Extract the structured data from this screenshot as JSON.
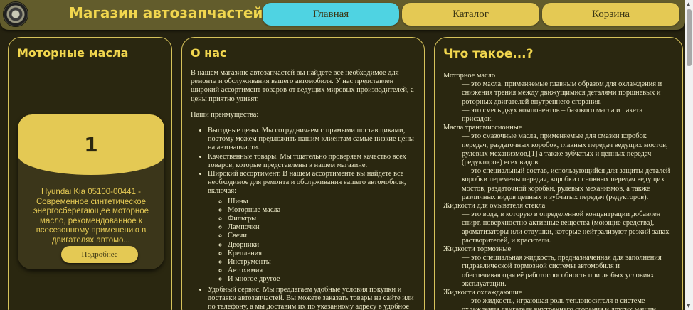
{
  "header": {
    "title": "Магазин автозапчастей",
    "nav": [
      "Главная",
      "Каталог",
      "Корзина"
    ]
  },
  "oils": {
    "title": "Моторные масла",
    "card": {
      "number": "1",
      "description": "Hyundai Kia 05100-00441 - Современное синтетическое энергосберегающее моторное масло, рекомендованное к всесезонному применению в двигателях автомо...",
      "button": "Подробнее"
    }
  },
  "about": {
    "title": "О нас",
    "intro": "В нашем магазине автозапчастей вы найдете все необходимое для ремонта и обслуживания вашего автомобиля. У нас представлен широкий ассортимент товаров от ведущих мировых производителей, а цены приятно удивят.",
    "advantages_heading": "Наши преимущества:",
    "advantages": [
      "Выгодные цены. Мы сотрудничаем с прямыми поставщиками, поэтому можем предложить нашим клиентам самые низкие цены на автозапчасти.",
      "Качественные товары. Мы тщательно проверяем качество всех товаров, которые представлены в нашем магазине.",
      "Широкий ассортимент. В нашем ассортименте вы найдете все необходимое для ремонта и обслуживания вашего автомобиля, включая:",
      "Удобный сервис. Мы предлагаем удобные условия покупки и доставки автозапчастей. Вы можете заказать товары на сайте или по телефону, а мы доставим их по указанному адресу в удобное для вас время."
    ],
    "assortment": [
      "Шины",
      "Моторные масла",
      "Фильтры",
      "Лампочки",
      "Свечи",
      "Дворники",
      "Крепления",
      "Инструменты",
      "Автохимия",
      "И многое другое"
    ]
  },
  "info": {
    "title": "Что такое...?",
    "terms": [
      {
        "term": "Моторное масло",
        "defs": [
          "— это масла, применяемые главным образом для охлаждения и снижения трения между движущимися деталями поршневых и роторных двигателей внутреннего сгорания.",
          "— это смесь двух компонентов – базового масла и пакета присадок."
        ]
      },
      {
        "term": "Масла трансмиссионные",
        "defs": [
          "— это смазочные масла, применяемые для смазки коробок передач, раздаточных коробок, главных передач ведущих мостов, рулевых механизмов,[1] а также зубчатых и цепных передач (редукторов) всех видов.",
          "— это специальный состав, использующийся для защиты деталей коробки перемены передач, коробки основных передач ведущих мостов, раздаточной коробки, рулевых механизмов, а также различных видов цепных и зубчатых передач (редукторов)."
        ]
      },
      {
        "term": "Жидкости для омывателя стекла",
        "defs": [
          "— это вода, в которую в определенной концентрации добавлен спирт, поверхностно-активные вещества (моющие средства), ароматизаторы или отдушки, которые нейтрализуют резкий запах растворителей, и красители."
        ]
      },
      {
        "term": "Жидкости тормозные",
        "defs": [
          "— это специальная жидкость, предназначенная для заполнения гидравлической тормозной системы автомобиля и обеспечивающая её работоспособность при любых условиях эксплуатации."
        ]
      },
      {
        "term": "Жидкости охлаждающие",
        "defs": [
          "— это жидкость, играющая роль теплоносителя в системе охлаждения двигателя внутреннего сгорания и других машин."
        ]
      }
    ]
  }
}
